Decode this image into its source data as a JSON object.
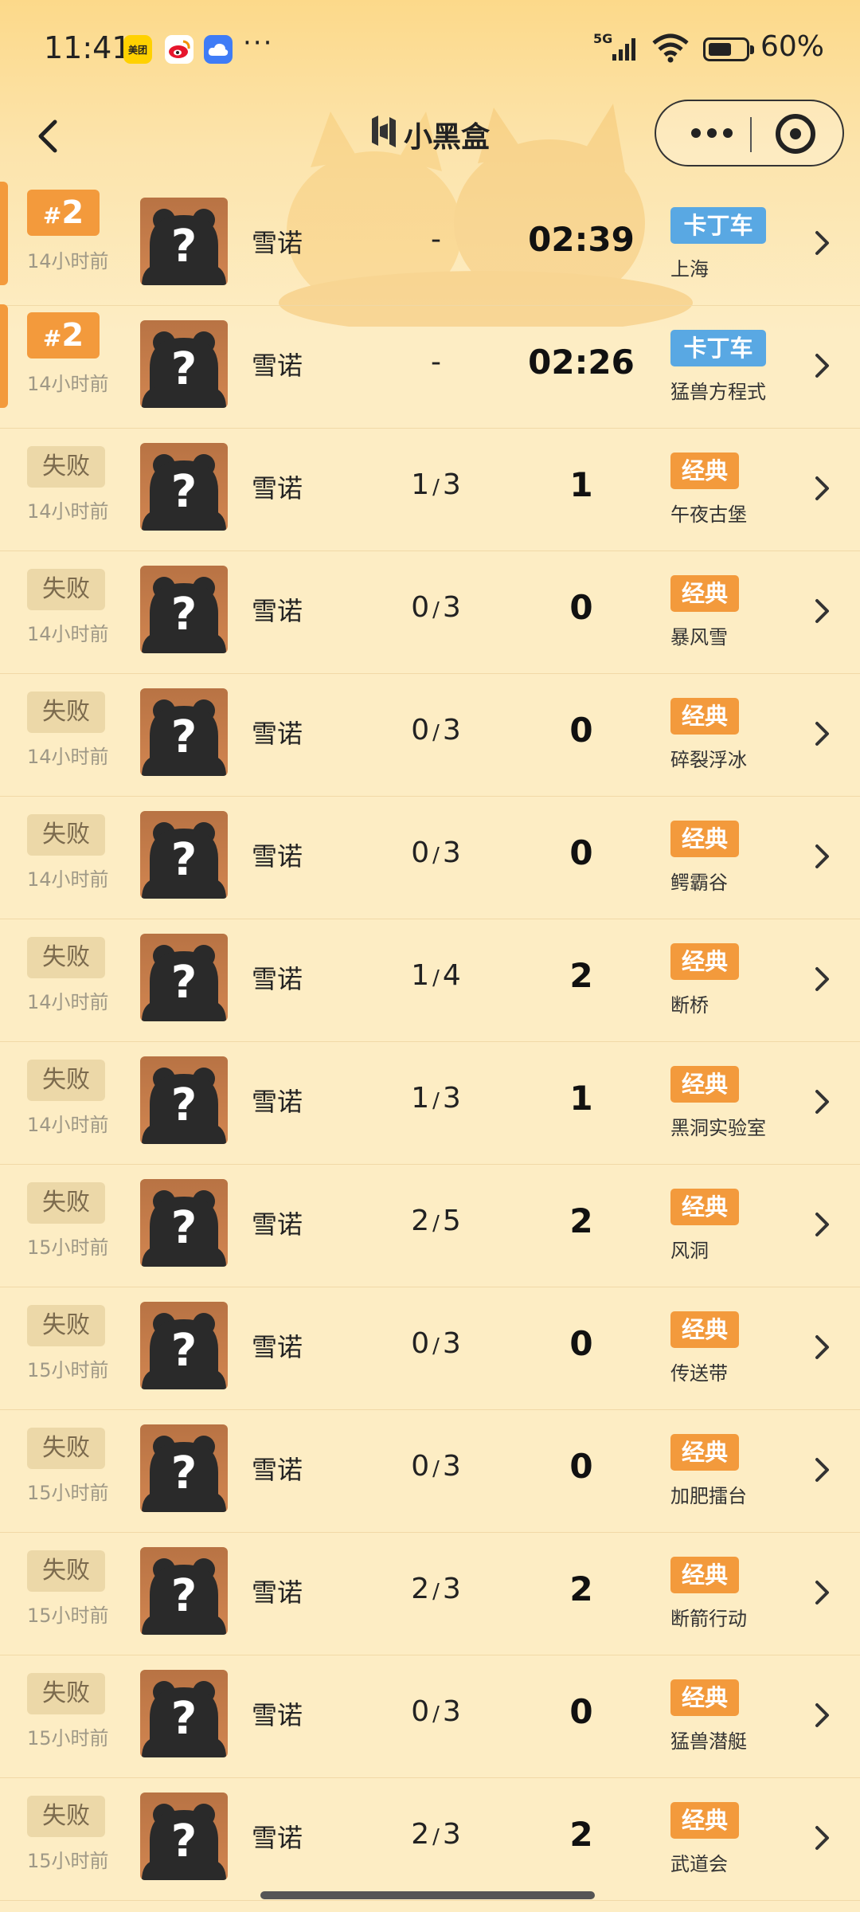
{
  "status_bar": {
    "time": "11:41",
    "network": "5G",
    "battery_percent": "60%",
    "battery_level": 0.6,
    "notification_icons": [
      "meituan-icon",
      "weibo-icon",
      "cloud-icon"
    ],
    "meituan_label": "美团",
    "more": "···"
  },
  "nav": {
    "brand": "小黑盒",
    "back_icon": "chevron-left-icon",
    "menu_icon": "more-dots-icon",
    "close_icon": "target-icon"
  },
  "colors": {
    "rank_badge": "#f39a3c",
    "classic_tag": "#f39a3c",
    "kart_tag": "#59a8e3",
    "fail_badge": "#ecd8a8"
  },
  "matches": [
    {
      "badge_type": "rank",
      "rank_hash": "#",
      "rank_num": "2",
      "time_ago": "14小时前",
      "player": "雪诺",
      "kd": "-",
      "score": "02:39",
      "mode": "卡丁车",
      "map": "上海"
    },
    {
      "badge_type": "rank",
      "rank_hash": "#",
      "rank_num": "2",
      "time_ago": "14小时前",
      "player": "雪诺",
      "kd": "-",
      "score": "02:26",
      "mode": "卡丁车",
      "map": "猛兽方程式"
    },
    {
      "badge_type": "fail",
      "result": "失败",
      "time_ago": "14小时前",
      "player": "雪诺",
      "kd_a": "1",
      "kd_b": "3",
      "score": "1",
      "mode": "经典",
      "map": "午夜古堡"
    },
    {
      "badge_type": "fail",
      "result": "失败",
      "time_ago": "14小时前",
      "player": "雪诺",
      "kd_a": "0",
      "kd_b": "3",
      "score": "0",
      "mode": "经典",
      "map": "暴风雪"
    },
    {
      "badge_type": "fail",
      "result": "失败",
      "time_ago": "14小时前",
      "player": "雪诺",
      "kd_a": "0",
      "kd_b": "3",
      "score": "0",
      "mode": "经典",
      "map": "碎裂浮冰"
    },
    {
      "badge_type": "fail",
      "result": "失败",
      "time_ago": "14小时前",
      "player": "雪诺",
      "kd_a": "0",
      "kd_b": "3",
      "score": "0",
      "mode": "经典",
      "map": "鳄霸谷"
    },
    {
      "badge_type": "fail",
      "result": "失败",
      "time_ago": "14小时前",
      "player": "雪诺",
      "kd_a": "1",
      "kd_b": "4",
      "score": "2",
      "mode": "经典",
      "map": "断桥"
    },
    {
      "badge_type": "fail",
      "result": "失败",
      "time_ago": "14小时前",
      "player": "雪诺",
      "kd_a": "1",
      "kd_b": "3",
      "score": "1",
      "mode": "经典",
      "map": "黑洞实验室"
    },
    {
      "badge_type": "fail",
      "result": "失败",
      "time_ago": "15小时前",
      "player": "雪诺",
      "kd_a": "2",
      "kd_b": "5",
      "score": "2",
      "mode": "经典",
      "map": "风洞"
    },
    {
      "badge_type": "fail",
      "result": "失败",
      "time_ago": "15小时前",
      "player": "雪诺",
      "kd_a": "0",
      "kd_b": "3",
      "score": "0",
      "mode": "经典",
      "map": "传送带"
    },
    {
      "badge_type": "fail",
      "result": "失败",
      "time_ago": "15小时前",
      "player": "雪诺",
      "kd_a": "0",
      "kd_b": "3",
      "score": "0",
      "mode": "经典",
      "map": "加肥擂台"
    },
    {
      "badge_type": "fail",
      "result": "失败",
      "time_ago": "15小时前",
      "player": "雪诺",
      "kd_a": "2",
      "kd_b": "3",
      "score": "2",
      "mode": "经典",
      "map": "断箭行动"
    },
    {
      "badge_type": "fail",
      "result": "失败",
      "time_ago": "15小时前",
      "player": "雪诺",
      "kd_a": "0",
      "kd_b": "3",
      "score": "0",
      "mode": "经典",
      "map": "猛兽潜艇"
    },
    {
      "badge_type": "fail",
      "result": "失败",
      "time_ago": "15小时前",
      "player": "雪诺",
      "kd_a": "2",
      "kd_b": "3",
      "score": "2",
      "mode": "经典",
      "map": "武道会"
    }
  ]
}
